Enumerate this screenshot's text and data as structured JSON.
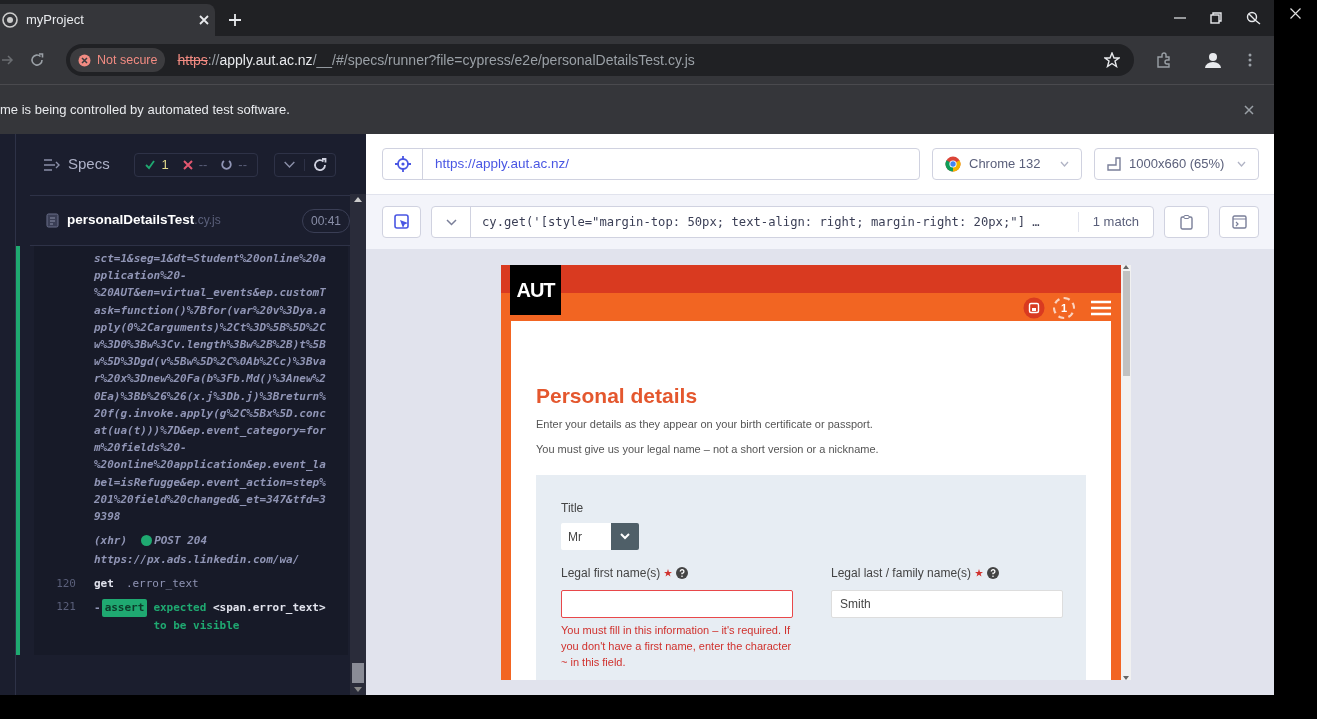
{
  "browser_tab": {
    "title": "myProject"
  },
  "address_bar": {
    "security_label": "Not secure",
    "url_scheme": "https",
    "url_separator": "://",
    "url_host": "apply.aut.ac.nz",
    "url_path": "/__/#/specs/runner?file=cypress/e2e/personalDetailsTest.cy.js"
  },
  "infobar": {
    "message": "me is being controlled by automated test software."
  },
  "specs_panel": {
    "title": "Specs",
    "passed": "1",
    "failed": "--",
    "pending": "--",
    "spec": {
      "name": "personalDetailsTest",
      "extension": ".cy.js",
      "duration": "00:41"
    },
    "log": [
      {
        "kind": "output",
        "text": "sct=1&seg=1&dt=Student%20online%20application%20-%20AUT&en=virtual_events&ep.customTask=function()%7Bfor(var%20v%3Dya.apply(0%2Carguments)%2Ct%3D%5B%5D%2Cw%3D0%3Bw%3Cv.length%3Bw%2B%2B)t%5Bw%5D%3Dgd(v%5Bw%5D%2C%0Ab%2Cc)%3Bvar%20x%3Dnew%20Fa(b%3Fb.Md()%3Anew%20Ea)%3Bb%26%26(x.j%3Db.j)%3Breturn%20f(g.invoke.apply(g%2C%5Bx%5D.concat(ua(t)))%7D&ep.event_category=form%20fields%20-%20online%20application&ep.event_label=isRefugge&ep.event_action=step%201%20field%20changed&_et=347&tfd=39398"
      },
      {
        "kind": "xhr",
        "label": "(xhr)",
        "method": "POST 204",
        "url": "https://px.ads.linkedin.com/wa/",
        "color": "#1fa971"
      },
      {
        "kind": "command",
        "number": "120",
        "name": "get",
        "message": ".error_text"
      },
      {
        "kind": "assert",
        "number": "121",
        "prefix": "-",
        "name": "assert",
        "message": "expected **<span.error_text>** to be visible"
      }
    ]
  },
  "aut_toolbar": {
    "url": "https://apply.aut.ac.nz/",
    "browser": "Chrome 132",
    "viewport": "1000x660 (65%)"
  },
  "selector_playground": {
    "selector": "cy.get('[style=\"margin-top: 50px; text-align: right; margin-right: 20px;\"] …",
    "matches": "1 match"
  },
  "app": {
    "logo": "AUT",
    "progress_step": "1",
    "heading": "Personal details",
    "intro": [
      "Enter your details as they appear on your birth certificate or passport.",
      "You must give us your legal name – not a short version or a nickname."
    ],
    "form": {
      "title_label": "Title",
      "title_value": "Mr",
      "fields": [
        {
          "label": "Legal first name(s)",
          "required": true,
          "invalid": true,
          "error": "You must fill in this information – it's required. If you don't have a first name, enter the character ~ in this field."
        },
        {
          "label": "Legal last / family name(s)",
          "required": true,
          "invalid": false,
          "value": "Smith"
        }
      ]
    }
  }
}
